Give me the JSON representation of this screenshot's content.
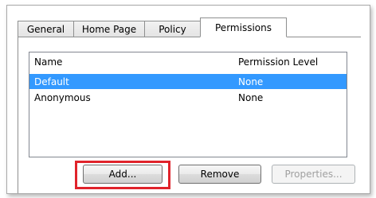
{
  "tabs": [
    {
      "label": "General"
    },
    {
      "label": "Home Page"
    },
    {
      "label": "Policy"
    },
    {
      "label": "Permissions",
      "selected": true
    }
  ],
  "permissions_list": {
    "columns": [
      "Name",
      "Permission Level"
    ],
    "rows": [
      {
        "name": "Default",
        "level": "None",
        "selected": true
      },
      {
        "name": "Anonymous",
        "level": "None",
        "selected": false
      }
    ]
  },
  "buttons": {
    "add": "Add...",
    "remove": "Remove",
    "properties": "Properties...",
    "properties_enabled": false
  },
  "colors": {
    "selection": "#3399ff",
    "highlight_box": "#e0232b"
  }
}
